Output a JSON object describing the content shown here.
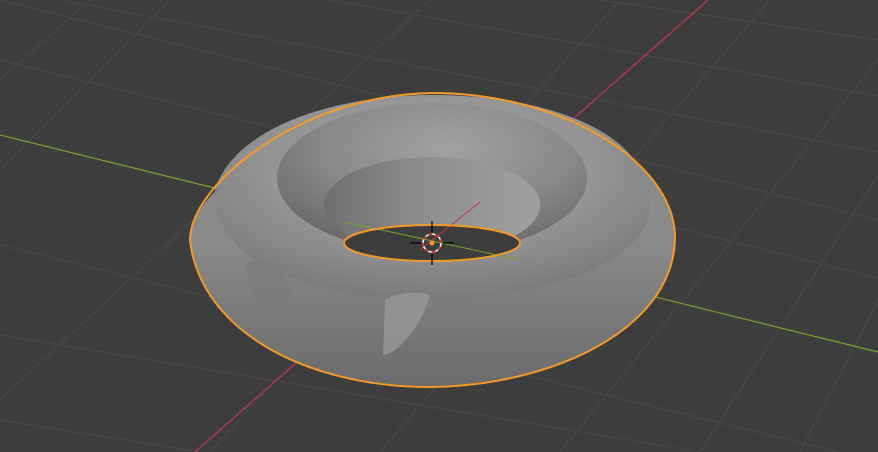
{
  "viewport": {
    "mode": "3d-viewport",
    "shading": "solid"
  },
  "scene": {
    "object": {
      "type": "torus",
      "selected": true,
      "base_color": "#8f8f8f"
    },
    "cursor": {
      "visible": true,
      "icon": "3d-cursor-icon"
    }
  },
  "colors": {
    "background": "#3d3d3d",
    "grid_line": "#4a4a4a",
    "x_axis": "#c0384f",
    "y_axis": "#7aa12e",
    "selection_outline": "#f19a2b",
    "cursor_red": "#d9453c"
  }
}
